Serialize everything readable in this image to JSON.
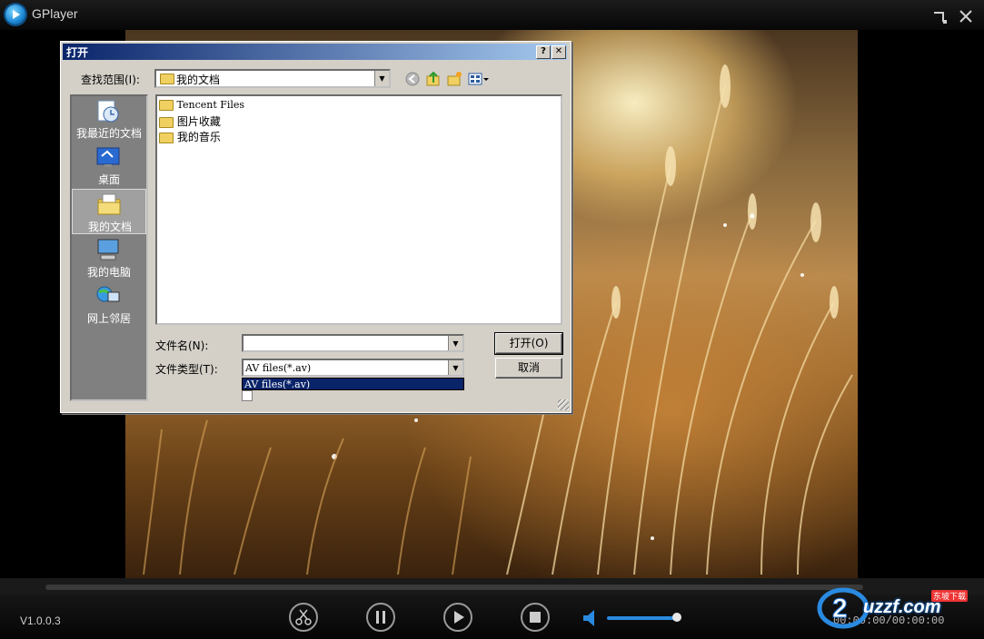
{
  "app": {
    "title": "GPlayer",
    "version": "V1.0.0.3",
    "time": "00:00:00/00:00:00"
  },
  "window_controls": {
    "minimize_icon": "minimize-icon",
    "close_icon": "close-icon"
  },
  "player": {
    "volume_level": 0.85,
    "accent": "#2a8ae0"
  },
  "dialog": {
    "title": "打开",
    "help_label": "?",
    "close_label": "✕",
    "look_in_label": "查找范围(I):",
    "look_in_value": "我的文档",
    "places": [
      {
        "label": "我最近的文档",
        "icon": "recent-documents-icon"
      },
      {
        "label": "桌面",
        "icon": "desktop-icon"
      },
      {
        "label": "我的文档",
        "icon": "my-documents-icon",
        "selected": true
      },
      {
        "label": "我的电脑",
        "icon": "my-computer-icon"
      },
      {
        "label": "网上邻居",
        "icon": "network-icon"
      }
    ],
    "files": [
      {
        "name": "Tencent Files",
        "icon": "folder-icon"
      },
      {
        "name": "图片收藏",
        "icon": "folder-icon"
      },
      {
        "name": "我的音乐",
        "icon": "folder-icon"
      }
    ],
    "filename_label": "文件名(N):",
    "filename_value": "",
    "filetype_label": "文件类型(T):",
    "filetype_value": "AV files(*.av)",
    "dropdown_option": "AV files(*.av)",
    "open_button": "打开(O)",
    "cancel_button": "取消"
  },
  "watermark": {
    "text": "uzzf.com",
    "badge": "东坡下载"
  }
}
